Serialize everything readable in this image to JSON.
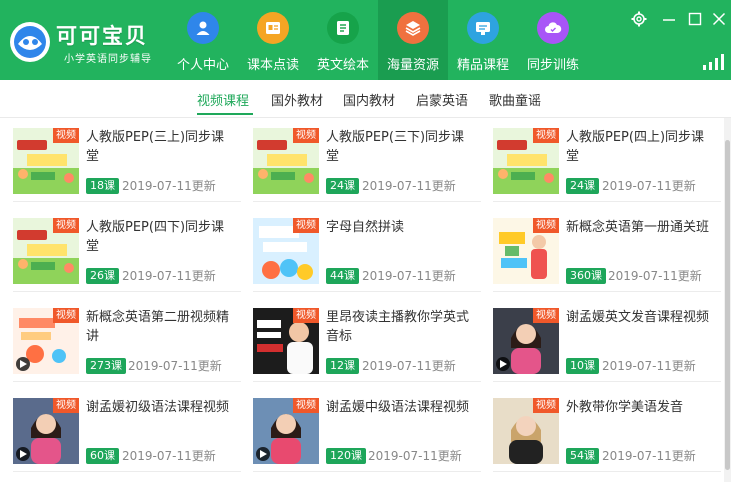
{
  "app": {
    "logo_title": "可可宝贝",
    "logo_subtitle": "小学英语同步辅导"
  },
  "nav": [
    {
      "label": "个人中心",
      "icon": "user-icon",
      "color": "#2f86ea",
      "active": false
    },
    {
      "label": "课本点读",
      "icon": "book-read-icon",
      "color": "#f5a524",
      "active": false
    },
    {
      "label": "英文绘本",
      "icon": "picture-book-icon",
      "color": "#16a34a",
      "active": false
    },
    {
      "label": "海量资源",
      "icon": "layers-icon",
      "color": "#f0713f",
      "active": true
    },
    {
      "label": "精品课程",
      "icon": "course-icon",
      "color": "#2ea3e0",
      "active": false
    },
    {
      "label": "同步训练",
      "icon": "cloud-icon",
      "color": "#a855f7",
      "active": false
    }
  ],
  "categories": [
    "视频课程",
    "国外教材",
    "国内教材",
    "启蒙英语",
    "歌曲童谣"
  ],
  "active_category": 0,
  "badge_label": "视频",
  "courses": [
    {
      "title": "人教版PEP(三上)同步课堂",
      "count": "18课",
      "date": "2019-07-11更新",
      "thumb": "textbook"
    },
    {
      "title": "人教版PEP(三下)同步课堂",
      "count": "24课",
      "date": "2019-07-11更新",
      "thumb": "textbook"
    },
    {
      "title": "人教版PEP(四上)同步课堂",
      "count": "24课",
      "date": "2019-07-11更新",
      "thumb": "textbook"
    },
    {
      "title": "人教版PEP(四下)同步课堂",
      "count": "26课",
      "date": "2019-07-11更新",
      "thumb": "textbook"
    },
    {
      "title": "字母自然拼读",
      "count": "44课",
      "date": "2019-07-11更新",
      "thumb": "phonics"
    },
    {
      "title": "新概念英语第一册通关班",
      "count": "360课",
      "date": "2019-07-11更新",
      "thumb": "newconcept1"
    },
    {
      "title": "新概念英语第二册视频精讲",
      "count": "273课",
      "date": "2019-07-11更新",
      "thumb": "newconcept2"
    },
    {
      "title": "里昂夜读主播教你学英式音标",
      "count": "12课",
      "date": "2019-07-11更新",
      "thumb": "host"
    },
    {
      "title": "谢孟媛英文发音课程视频",
      "count": "10课",
      "date": "2019-07-11更新",
      "thumb": "teacher"
    },
    {
      "title": "谢孟媛初级语法课程视频",
      "count": "60课",
      "date": "2019-07-11更新",
      "thumb": "teacher2"
    },
    {
      "title": "谢孟媛中级语法课程视频",
      "count": "120课",
      "date": "2019-07-11更新",
      "thumb": "teacher3"
    },
    {
      "title": "外教带你学美语发音",
      "count": "54课",
      "date": "2019-07-11更新",
      "thumb": "foreign"
    }
  ]
}
